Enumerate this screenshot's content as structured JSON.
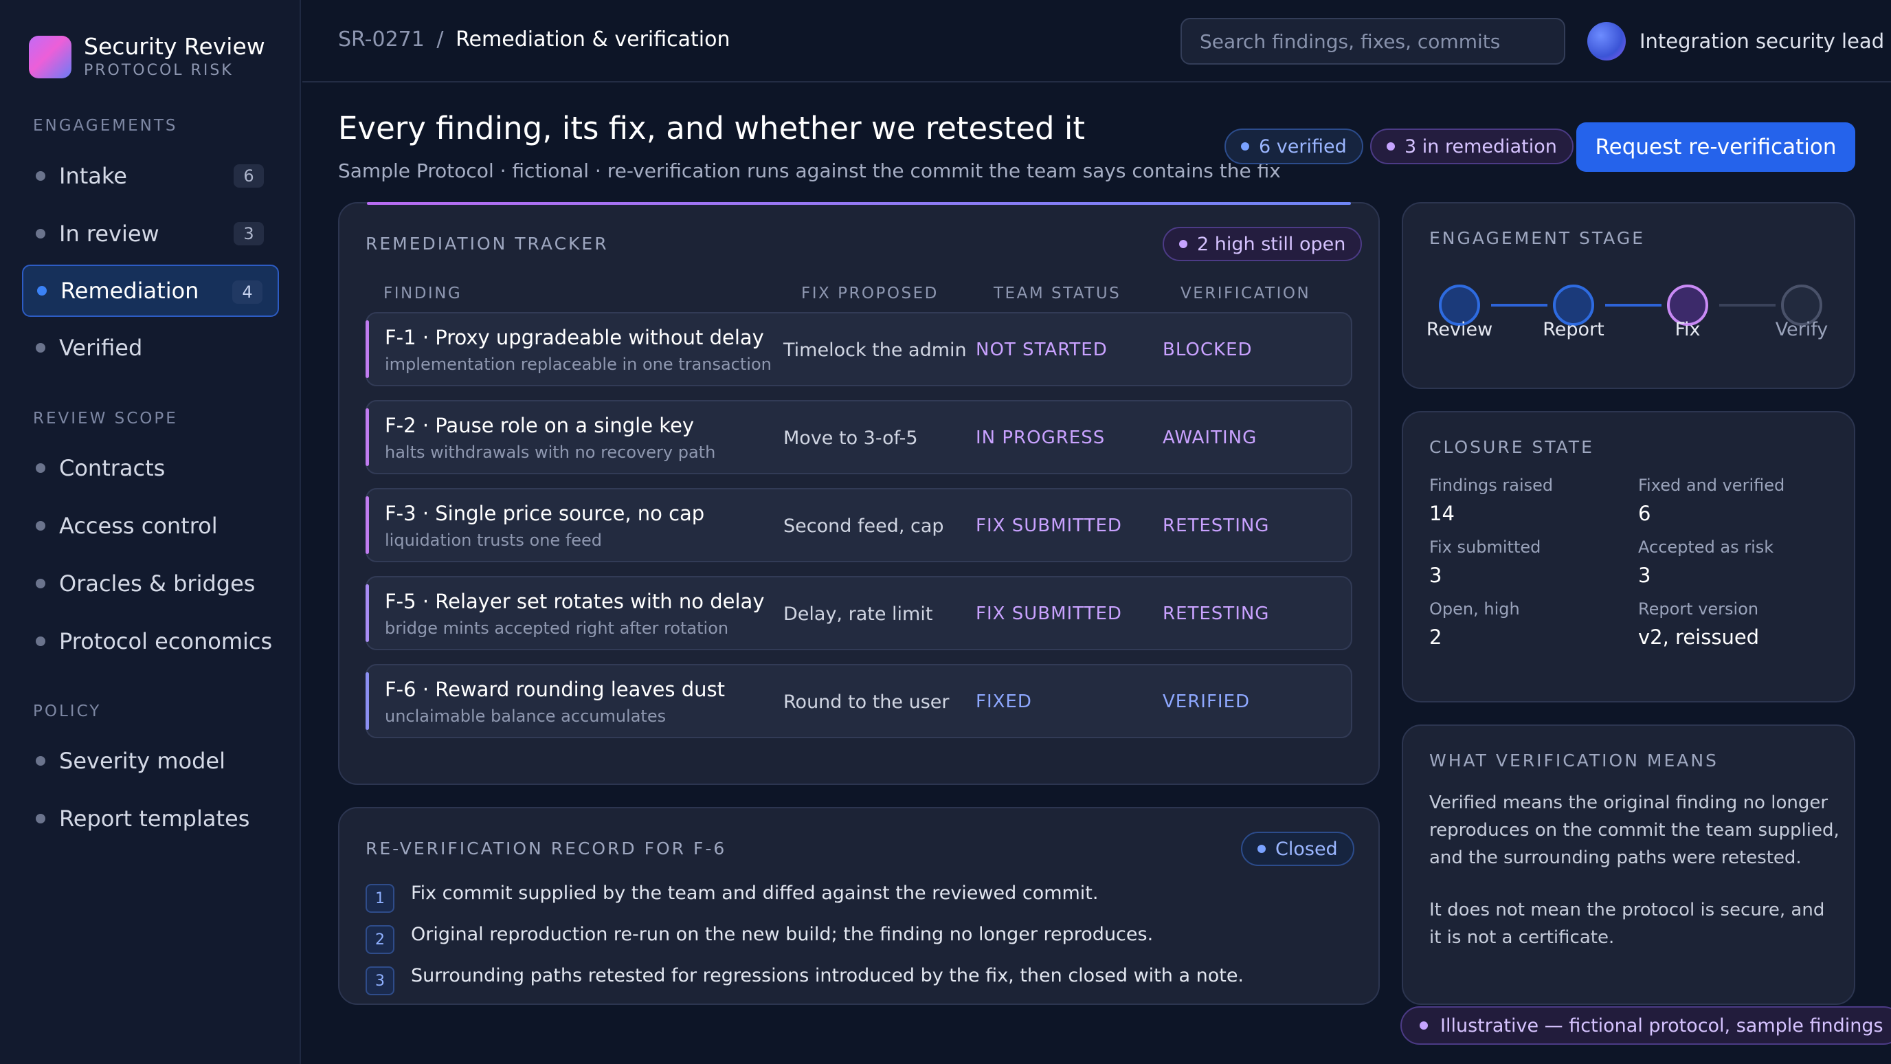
{
  "brand": {
    "title": "Security Review",
    "subtitle": "PROTOCOL RISK"
  },
  "sidebar": {
    "sections": [
      {
        "label": "ENGAGEMENTS",
        "items": [
          {
            "label": "Intake",
            "count": "6"
          },
          {
            "label": "In review",
            "count": "3"
          },
          {
            "label": "Remediation",
            "count": "4",
            "active": true
          },
          {
            "label": "Verified"
          }
        ]
      },
      {
        "label": "REVIEW SCOPE",
        "items": [
          {
            "label": "Contracts"
          },
          {
            "label": "Access control"
          },
          {
            "label": "Oracles & bridges"
          },
          {
            "label": "Protocol economics"
          }
        ]
      },
      {
        "label": "POLICY",
        "items": [
          {
            "label": "Severity model"
          },
          {
            "label": "Report templates"
          }
        ]
      }
    ]
  },
  "topbar": {
    "breadcrumb_id": "SR-0271",
    "breadcrumb_sep": "/",
    "breadcrumb_current": "Remediation & verification",
    "search_placeholder": "Search findings, fixes, commits",
    "user_name": "Integration security lead"
  },
  "header": {
    "title": "Every finding, its fix, and whether we retested it",
    "subtitle": "Sample Protocol · fictional · re-verification runs against the commit the team says contains the fix",
    "pill_verified": "6 verified",
    "pill_remediation": "3 in remediation",
    "cta": "Request re-verification"
  },
  "tracker": {
    "label": "REMEDIATION TRACKER",
    "badge": "2 high still open",
    "columns": [
      "FINDING",
      "FIX PROPOSED",
      "TEAM STATUS",
      "VERIFICATION"
    ],
    "rows": [
      {
        "title": "F-1 · Proxy upgradeable without delay",
        "sub": "implementation replaceable in one transaction",
        "fix": "Timelock the admin",
        "status": "NOT STARTED",
        "verification": "BLOCKED"
      },
      {
        "title": "F-2 · Pause role on a single key",
        "sub": "halts withdrawals with no recovery path",
        "fix": "Move to 3-of-5",
        "status": "IN PROGRESS",
        "verification": "AWAITING"
      },
      {
        "title": "F-3 · Single price source, no cap",
        "sub": "liquidation trusts one feed",
        "fix": "Second feed, cap",
        "status": "FIX SUBMITTED",
        "verification": "RETESTING"
      },
      {
        "title": "F-5 · Relayer set rotates with no delay",
        "sub": "bridge mints accepted right after rotation",
        "fix": "Delay, rate limit",
        "status": "FIX SUBMITTED",
        "verification": "RETESTING"
      },
      {
        "title": "F-6 · Reward rounding leaves dust",
        "sub": "unclaimable balance accumulates",
        "fix": "Round to the user",
        "status": "FIXED",
        "verification": "VERIFIED"
      }
    ],
    "colors": {
      "purple": "#c9a2ff",
      "blue": "#8ea8ff",
      "accent_purple": "#c07cf0",
      "accent_blue": "#8b8ff2"
    }
  },
  "record": {
    "label": "RE-VERIFICATION RECORD FOR F-6",
    "badge": "Closed",
    "steps": [
      {
        "n": "1",
        "text": "Fix commit supplied by the team and diffed against the reviewed commit."
      },
      {
        "n": "2",
        "text": "Original reproduction re-run on the new build; the finding no longer reproduces."
      },
      {
        "n": "3",
        "text": "Surrounding paths retested for regressions introduced by the fix, then closed with a note."
      }
    ]
  },
  "stage": {
    "label": "ENGAGEMENT STAGE",
    "steps": [
      {
        "label": "Review",
        "state": "done"
      },
      {
        "label": "Report",
        "state": "done"
      },
      {
        "label": "Fix",
        "state": "current"
      },
      {
        "label": "Verify",
        "state": "pending"
      }
    ]
  },
  "closure": {
    "label": "CLOSURE STATE",
    "stats": [
      {
        "label": "Findings raised",
        "value": "14"
      },
      {
        "label": "Fixed and verified",
        "value": "6"
      },
      {
        "label": "Fix submitted",
        "value": "3"
      },
      {
        "label": "Accepted as risk",
        "value": "3"
      },
      {
        "label": "Open, high",
        "value": "2"
      },
      {
        "label": "Report version",
        "value": "v2, reissued"
      }
    ]
  },
  "meaning": {
    "label": "WHAT VERIFICATION MEANS",
    "p1": "Verified means the original finding no longer reproduces on the commit the team supplied, and the surrounding paths were retested.",
    "p2": "It does not mean the protocol is secure, and it is not a certificate."
  },
  "footer_pill": "Illustrative — fictional protocol, sample findings"
}
